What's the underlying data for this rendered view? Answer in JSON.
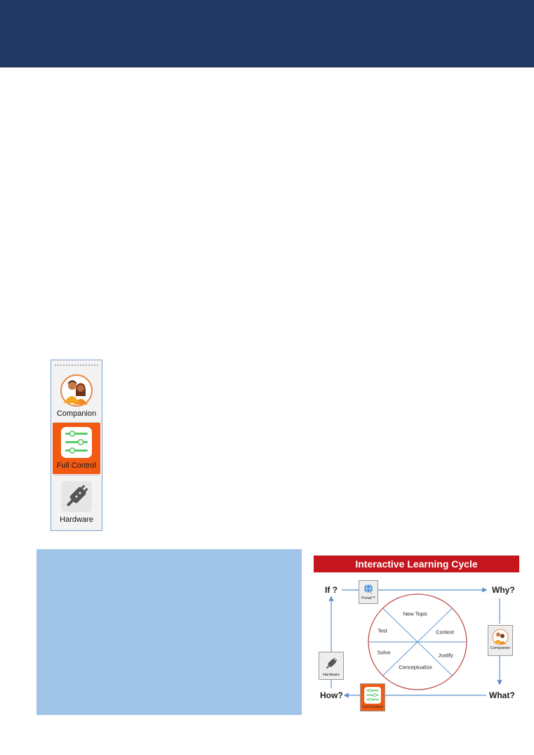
{
  "toolbar": {
    "items": [
      {
        "label": "Companion",
        "icon": "companion-icon",
        "selected": false
      },
      {
        "label": "Full Control",
        "icon": "sliders-icon",
        "selected": true
      },
      {
        "label": "Hardware",
        "icon": "plug-icon",
        "selected": false
      }
    ]
  },
  "cycle": {
    "title": "Interactive Learning Cycle",
    "corners": {
      "if": "If ?",
      "why": "Why?",
      "what": "What?",
      "how": "How?"
    },
    "nodes": {
      "portal": "Portal™",
      "companion": "Companion",
      "full_control": "Full Control",
      "hardware": "Hardware"
    },
    "wheel": [
      "New Topic",
      "Context",
      "Justify",
      "Conceptualize",
      "Solve",
      "Test"
    ]
  },
  "colors": {
    "header": "#213a63",
    "accent_orange": "#f25a13",
    "note_box": "#9fc4e7",
    "title_red": "#c4161c",
    "arrow_blue": "#5b8fc9",
    "wheel_red": "#c0504d"
  }
}
